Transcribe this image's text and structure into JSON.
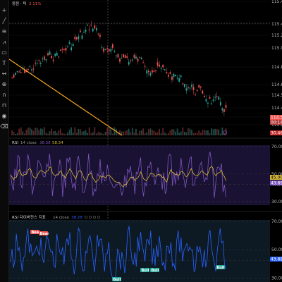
{
  "symbol": {
    "name": "동원 · 틱",
    "change": "2.11%"
  },
  "price_axis": {
    "labels": [
      "115.48",
      "115.44",
      "115.20",
      "115.00",
      "114.80",
      "114.60",
      "114.50",
      "114.40",
      "114.30",
      "114.20"
    ],
    "current_price": "114.30",
    "current_sub": "00:14",
    "low_tag": "30.46"
  },
  "rsi_pane": {
    "title": "RSI",
    "params": "14 close",
    "value_a": "38.58",
    "value_b": "58.54",
    "levels": [
      "70.00",
      "50.00",
      "40.00",
      "30.00"
    ],
    "tag_a": "45.00",
    "tag_b": "43.89"
  },
  "div_pane": {
    "title": "RSI 다이버전스 지표",
    "params": "14 close",
    "value": "38.28",
    "levels": [
      "70.00",
      "50.00",
      "40.00",
      "30.00"
    ],
    "tag": "43.88",
    "badges": [
      {
        "label": "Bear"
      },
      {
        "label": "Bear"
      },
      {
        "label": "Bull"
      },
      {
        "label": "Bull"
      },
      {
        "label": "Bull"
      },
      {
        "label": "Bull"
      }
    ]
  },
  "toolbar": {
    "tools": [
      {
        "name": "crosshair-icon",
        "glyph": "+"
      },
      {
        "name": "trend-line-icon",
        "glyph": "╱"
      },
      {
        "name": "fib-icon",
        "glyph": "≋"
      },
      {
        "name": "pattern-icon",
        "glyph": "⩘"
      },
      {
        "name": "rectangle-icon",
        "glyph": "▭"
      },
      {
        "name": "text-icon",
        "glyph": "T"
      },
      {
        "name": "measure-icon",
        "glyph": "↔"
      },
      {
        "name": "zoom-icon",
        "glyph": "⊕"
      },
      {
        "name": "magnet-icon",
        "glyph": "∩"
      },
      {
        "name": "lock-icon",
        "glyph": "⊓"
      },
      {
        "name": "eye-icon",
        "glyph": "◉"
      },
      {
        "name": "trash-icon",
        "glyph": "⌫"
      }
    ]
  },
  "colors": {
    "up": "#26a69a",
    "down": "#ef5350",
    "rsi_line": "#7e57c2",
    "rsi_ma": "#d4b73a",
    "div_line": "#2962ff",
    "trendline": "#f5a623",
    "bull": "#26a69a",
    "bear": "#ef5350"
  }
}
